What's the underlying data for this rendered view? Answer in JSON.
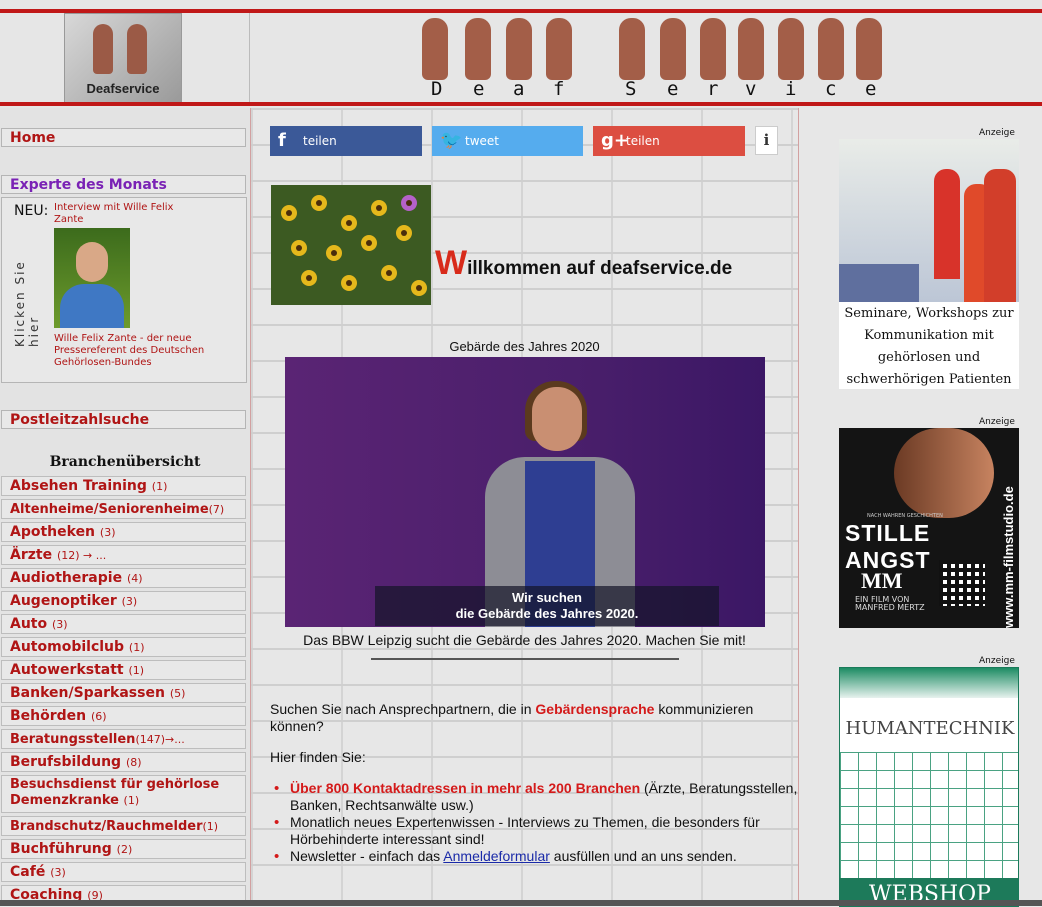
{
  "header": {
    "logo_label": "Deafservice",
    "banner_letters": [
      "D",
      "e",
      "a",
      "f",
      "S",
      "e",
      "r",
      "v",
      "i",
      "c",
      "e"
    ]
  },
  "sidebar": {
    "home": "Home",
    "expert": "Experte des Monats",
    "neu": "NEU:",
    "interview": "Interview mit Wille Felix Zante",
    "vertical": "Klicken Sie hier",
    "zante": "Wille Felix Zante - der neue Pressereferent des Deutschen Gehörlosen-Bundes",
    "plz": "Postleitzahlsuche",
    "branchen_title": "Branchenübersicht",
    "categories": [
      {
        "label": "Absehen Training",
        "count": "(1)"
      },
      {
        "label": "Altenheime/Seniorenheime",
        "count": "(7)"
      },
      {
        "label": "Apotheken",
        "count": "(3)"
      },
      {
        "label": "Ärzte",
        "count": "(12) → ..."
      },
      {
        "label": "Audiotherapie",
        "count": "(4)"
      },
      {
        "label": "Augenoptiker",
        "count": "(3)"
      },
      {
        "label": "Auto",
        "count": "(3)"
      },
      {
        "label": "Automobilclub",
        "count": "(1)"
      },
      {
        "label": "Autowerkstatt",
        "count": "(1)"
      },
      {
        "label": "Banken/Sparkassen",
        "count": "(5)"
      },
      {
        "label": "Behörden",
        "count": "(6)"
      },
      {
        "label": "Beratungsstellen",
        "count": "(147)→..."
      },
      {
        "label": "Berufsbildung",
        "count": "(8)"
      },
      {
        "label": "Besuchsdienst für gehörlose Demenzkranke",
        "count": "(1)"
      },
      {
        "label": "Brandschutz/Rauchmelder",
        "count": "(1)"
      },
      {
        "label": "Buchführung",
        "count": "(2)"
      },
      {
        "label": "Café",
        "count": "(3)"
      },
      {
        "label": "Coaching",
        "count": "(9)"
      }
    ]
  },
  "share": {
    "facebook": "teilen",
    "twitter": "tweet",
    "google": "teilen",
    "info": "i"
  },
  "main": {
    "welcome_big": "W",
    "welcome_rest": "illkommen auf deafservice.de",
    "geb_title": "Gebärde des Jahres 2020",
    "video_caption_line1": "Wir suchen",
    "video_caption_line2": "die Gebärde des Jahres 2020.",
    "video_text": "Das BBW Leipzig sucht die Gebärde des Jahres 2020. Machen Sie mit!",
    "intro_a": "Suchen Sie nach Ansprechpartnern, die in ",
    "intro_red": "Gebärdensprache",
    "intro_b": " kommunizieren können?",
    "hier": "Hier finden Sie:",
    "b1_red": "Über 800 Kontaktadressen in mehr als 200 Branchen",
    "b1_rest": " (Ärzte, Beratungsstellen, Banken, Rechtsanwälte usw.)",
    "b2": "Monatlich neues Expertenwissen - Interviews zu Themen, die besonders für Hörbehinderte interessant sind!",
    "b3_a": "Newsletter - einfach das ",
    "b3_link": "Anmeldeformular",
    "b3_b": " ausfüllen und an uns senden."
  },
  "ads": {
    "anzeige": "Anzeige",
    "ad1_text": "Seminare, Workshops zur Kommunikation mit gehörlosen und schwerhörigen Patienten",
    "ad2_small": "NACH WAHREN GESCHICHTEN",
    "ad2_title": "STILLE ANGST",
    "ad2_mm": "MM",
    "ad2_film1": "EIN FILM VON",
    "ad2_film2": "MANFRED MERTZ",
    "ad2_url": "www.mm-filmstudio.de",
    "ad3_brand": "HUMANTECHNIK",
    "ad3_shop": "WEBSHOP"
  }
}
